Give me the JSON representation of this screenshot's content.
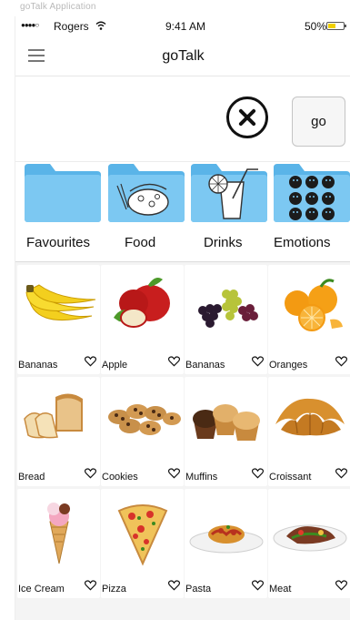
{
  "window_caption": "goTalk Application",
  "status_bar": {
    "carrier": "Rogers",
    "time": "9:41 AM",
    "battery_percent": "50%",
    "battery_level": 0.5,
    "signal_icon": "signal-dots-icon",
    "wifi_icon": "wifi-icon"
  },
  "nav": {
    "title": "goTalk",
    "menu_icon": "hamburger-menu-icon"
  },
  "input_bar": {
    "clear_icon": "clear-circle-x-icon",
    "go_label": "go"
  },
  "categories": [
    {
      "label": "Favourites",
      "icon": "folder-icon"
    },
    {
      "label": "Food",
      "icon": "food-folder-icon"
    },
    {
      "label": "Drinks",
      "icon": "drinks-folder-icon"
    },
    {
      "label": "Emotions",
      "icon": "emotions-folder-icon"
    }
  ],
  "tiles": [
    {
      "label": "Bananas",
      "image": "bananas-image"
    },
    {
      "label": "Apple",
      "image": "apple-image"
    },
    {
      "label": "Bananas",
      "image": "grapes-image"
    },
    {
      "label": "Oranges",
      "image": "oranges-image"
    },
    {
      "label": "Bread",
      "image": "bread-image"
    },
    {
      "label": "Cookies",
      "image": "cookies-image"
    },
    {
      "label": "Muffins",
      "image": "muffins-image"
    },
    {
      "label": "Croissant",
      "image": "croissant-image"
    },
    {
      "label": "Ice Cream",
      "image": "ice-cream-image"
    },
    {
      "label": "Pizza",
      "image": "pizza-image"
    },
    {
      "label": "Pasta",
      "image": "pasta-image"
    },
    {
      "label": "Meat",
      "image": "meat-image"
    }
  ],
  "colors": {
    "folder_blue": "#5ab4e8",
    "folder_tab": "#7cc8f2",
    "battery_yellow": "#f1d000",
    "grid_background": "#f4f4f4"
  }
}
